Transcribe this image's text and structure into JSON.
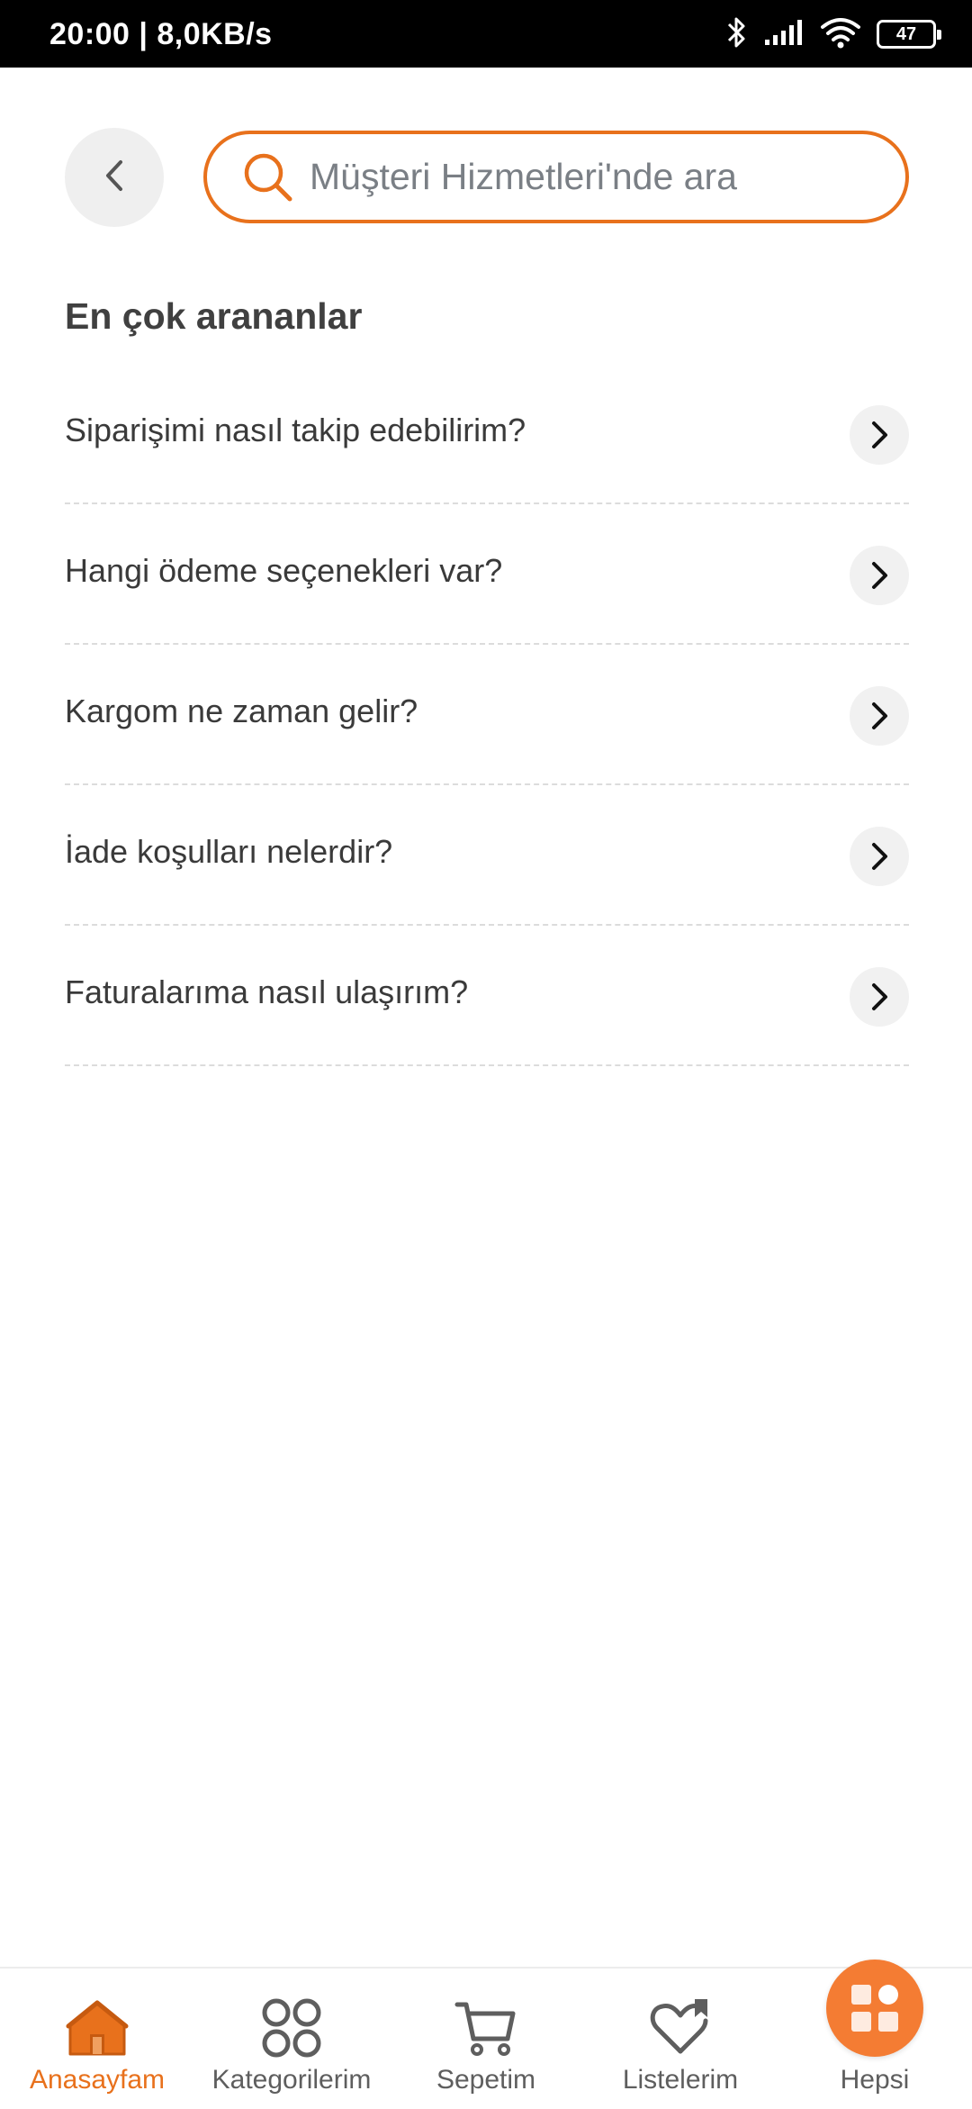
{
  "status_bar": {
    "time_speed": "20:00 | 8,0KB/s",
    "battery_level": "47",
    "battery_percent": 47,
    "icons": [
      "bluetooth-icon",
      "signal-icon",
      "wifi-icon",
      "battery-icon"
    ]
  },
  "header": {
    "back_icon": "chevron-left-icon",
    "search": {
      "placeholder": "Müşteri Hizmetleri'nde ara",
      "value": "",
      "icon": "search-icon"
    }
  },
  "section": {
    "title": "En çok arananlar",
    "items": [
      {
        "label": "Siparişimi nasıl takip edebilirim?"
      },
      {
        "label": "Hangi ödeme seçenekleri var?"
      },
      {
        "label": "Kargom ne zaman gelir?"
      },
      {
        "label": "İade koşulları nelerdir?"
      },
      {
        "label": "Faturalarıma nasıl ulaşırım?"
      }
    ]
  },
  "bottom_nav": {
    "items": [
      {
        "label": "Anasayfam",
        "icon": "home-icon",
        "active": true
      },
      {
        "label": "Kategorilerim",
        "icon": "categories-icon",
        "active": false
      },
      {
        "label": "Sepetim",
        "icon": "cart-icon",
        "active": false
      },
      {
        "label": "Listelerim",
        "icon": "heart-list-icon",
        "active": false
      },
      {
        "label": "Hepsi",
        "icon": "grid-apps-icon",
        "active": false
      }
    ]
  },
  "colors": {
    "accent": "#e8711c",
    "hepsi_bg": "#f47c33",
    "text_primary": "#3a3a3a",
    "status_bar_bg": "#000000"
  }
}
